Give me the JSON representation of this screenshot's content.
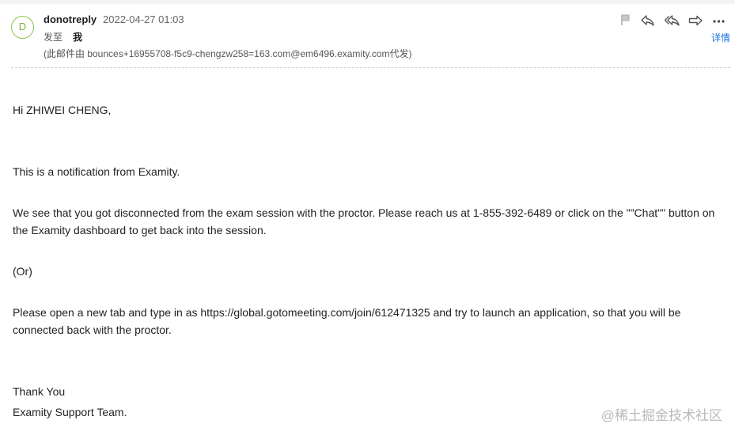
{
  "header": {
    "avatar_letter": "D",
    "sender": "donotreply",
    "date": "2022-04-27 01:03",
    "to_label": "发至",
    "to_value": "我",
    "on_behalf": "(此邮件由 bounces+16955708-f5c9-chengzw258=163.com@em6496.examity.com代发)",
    "details": "详情"
  },
  "toolbar": {
    "icons": [
      "flag-icon",
      "reply-icon",
      "reply-all-icon",
      "forward-icon",
      "more-icon"
    ]
  },
  "body": {
    "greeting": "Hi ZHIWEI CHENG,",
    "p1": "This is a notification from Examity.",
    "p2": "We see that you got disconnected from the exam session with the proctor. Please reach us at 1-855-392-6489 or click on the \"\"Chat\"\" button on the Examity dashboard to get back into the session.",
    "p3": "(Or)",
    "p4": "Please open a new tab and type in as https://global.gotomeeting.com/join/612471325 and try to launch an application, so that you will be connected back with the proctor.",
    "closing1": "Thank You",
    "closing2": "Examity Support Team."
  },
  "watermark": "@稀土掘金技术社区",
  "colors": {
    "avatar": "#8bc34a",
    "link": "#1a73e8"
  }
}
